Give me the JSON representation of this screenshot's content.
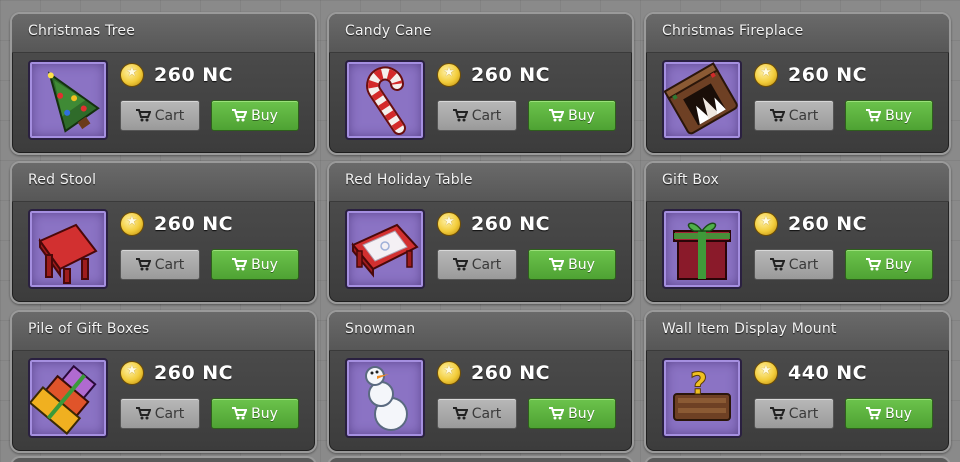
{
  "shop": {
    "currency_icon": "coin-icon",
    "buttons": {
      "cart_label": "Cart",
      "buy_label": "Buy"
    },
    "items": [
      {
        "name": "Christmas Tree",
        "price": "260 NC",
        "icon": "christmas-tree-icon"
      },
      {
        "name": "Candy Cane",
        "price": "260 NC",
        "icon": "candy-cane-icon"
      },
      {
        "name": "Christmas Fireplace",
        "price": "260 NC",
        "icon": "fireplace-icon"
      },
      {
        "name": "Red Stool",
        "price": "260 NC",
        "icon": "stool-icon"
      },
      {
        "name": "Red Holiday Table",
        "price": "260 NC",
        "icon": "table-icon"
      },
      {
        "name": "Gift Box",
        "price": "260 NC",
        "icon": "gift-box-icon"
      },
      {
        "name": "Pile of Gift Boxes",
        "price": "260 NC",
        "icon": "gift-pile-icon"
      },
      {
        "name": "Snowman",
        "price": "260 NC",
        "icon": "snowman-icon"
      },
      {
        "name": "Wall Item Display Mount",
        "price": "440 NC",
        "icon": "wall-mount-icon"
      }
    ]
  },
  "colors": {
    "buy_button": "#5bb33f",
    "cart_button": "#a8a8a8",
    "thumb_bg": "#8b73c4",
    "card_bg": "#4a4a4a"
  }
}
